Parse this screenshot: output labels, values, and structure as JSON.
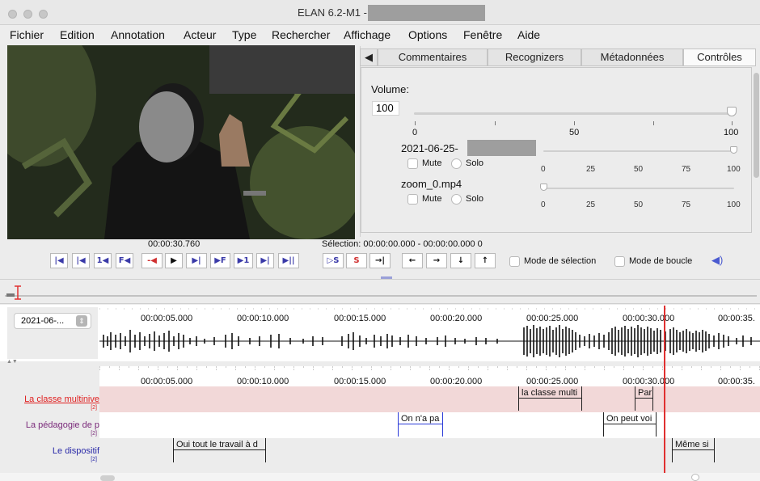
{
  "window": {
    "title": "ELAN 6.2-M1 -"
  },
  "menu": [
    "Fichier",
    "Edition",
    "Annotation",
    "Acteur",
    "Type",
    "Rechercher",
    "Affichage",
    "Options",
    "Fenêtre",
    "Aide"
  ],
  "tabs": [
    "Commentaires",
    "Recognizers",
    "Métadonnées",
    "Contrôles"
  ],
  "controls": {
    "volume_label": "Volume:",
    "volume_value": "100",
    "main_ticks": [
      "0",
      "50",
      "100"
    ],
    "track1_name": "2021-06-25-",
    "track2_name": "zoom_0.mp4",
    "mute_label": "Mute",
    "solo_label": "Solo",
    "track_ticks": [
      "0",
      "25",
      "50",
      "75",
      "100"
    ]
  },
  "player": {
    "time": "00:00:30.760",
    "selection": "Sélection: 00:00:00.000 - 00:00:00.000  0",
    "buttons": [
      "|◀",
      "|◀",
      "1◀",
      "F◀",
      "-◀",
      "▶",
      "▶|",
      "▶F",
      "▶1",
      "▶|",
      "▶||"
    ],
    "sel_buttons": [
      "▷S",
      "S",
      "→|"
    ],
    "arrow_buttons": [
      "←",
      "→",
      "↓",
      "↑"
    ],
    "mode_selection": "Mode de sélection",
    "mode_loop": "Mode de boucle"
  },
  "waveform": {
    "combo": "2021-06-...",
    "timestamps": [
      "00:00:05.000",
      "00:00:10.000",
      "00:00:15.000",
      "00:00:20.000",
      "00:00:25.000",
      "00:00:30.000",
      "00:00:35."
    ]
  },
  "timeline": {
    "timestamps": [
      "00:00:05.000",
      "00:00:10.000",
      "00:00:15.000",
      "00:00:20.000",
      "00:00:25.000",
      "00:00:30.000",
      "00:00:35."
    ]
  },
  "tiers": [
    {
      "name": "La classe multinive",
      "count": "[2]",
      "color": "#e02020"
    },
    {
      "name": "La pédagogie de p",
      "count": "[2]",
      "color": "#7a2a7a"
    },
    {
      "name": "Le dispositif",
      "count": "[2]",
      "color": "#2a2aa8"
    }
  ],
  "annotations": {
    "tier1": [
      "la classe multi",
      "Par"
    ],
    "tier2": [
      "On n'a pa",
      "On peut voi"
    ],
    "tier3": [
      "Oui tout le  travail à d",
      "Même si"
    ]
  },
  "colors": {
    "cursor": "#e03030",
    "tier1_bg": "#f2d8d8"
  }
}
